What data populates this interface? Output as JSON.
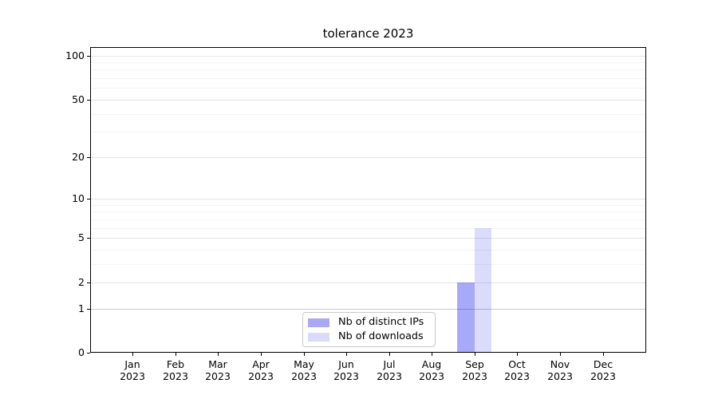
{
  "figure": {
    "background": "#ffffff"
  },
  "chart_data": {
    "type": "bar",
    "title": "tolerance 2023",
    "x": {
      "months": [
        "Jan",
        "Feb",
        "Mar",
        "Apr",
        "May",
        "Jun",
        "Jul",
        "Aug",
        "Sep",
        "Oct",
        "Nov",
        "Dec"
      ],
      "year": "2023"
    },
    "series": [
      {
        "name": "Nb of distinct IPs",
        "color_solid": "#a9a9f6",
        "color_rgba": "rgba(13,13,240,0.355)",
        "values": [
          0,
          0,
          0,
          0,
          0,
          0,
          0,
          0,
          2,
          0,
          0,
          0
        ]
      },
      {
        "name": "Nb of downloads",
        "color_solid": "#dbdbf9",
        "color_rgba": "rgba(13,13,240,0.149)",
        "values": [
          0,
          0,
          0,
          0,
          0,
          0,
          0,
          0,
          6,
          0,
          0,
          0
        ]
      }
    ],
    "y_axis": {
      "scale": "log1p",
      "major_ticks": [
        0,
        1,
        2,
        5,
        10,
        20,
        50,
        100
      ],
      "minor_ticks": [
        3,
        4,
        6,
        7,
        8,
        9,
        30,
        40,
        60,
        70,
        80,
        90
      ],
      "emphasized_gridline_value": 1,
      "ylim": [
        0,
        115
      ]
    },
    "grid": {
      "major_color": "#e4e4e4",
      "minor_color": "#f3f3f3",
      "emphasis_color": "#c8c8c8"
    },
    "legend": {
      "position": "lower center",
      "entries": [
        "Nb of distinct IPs",
        "Nb of downloads"
      ]
    }
  }
}
